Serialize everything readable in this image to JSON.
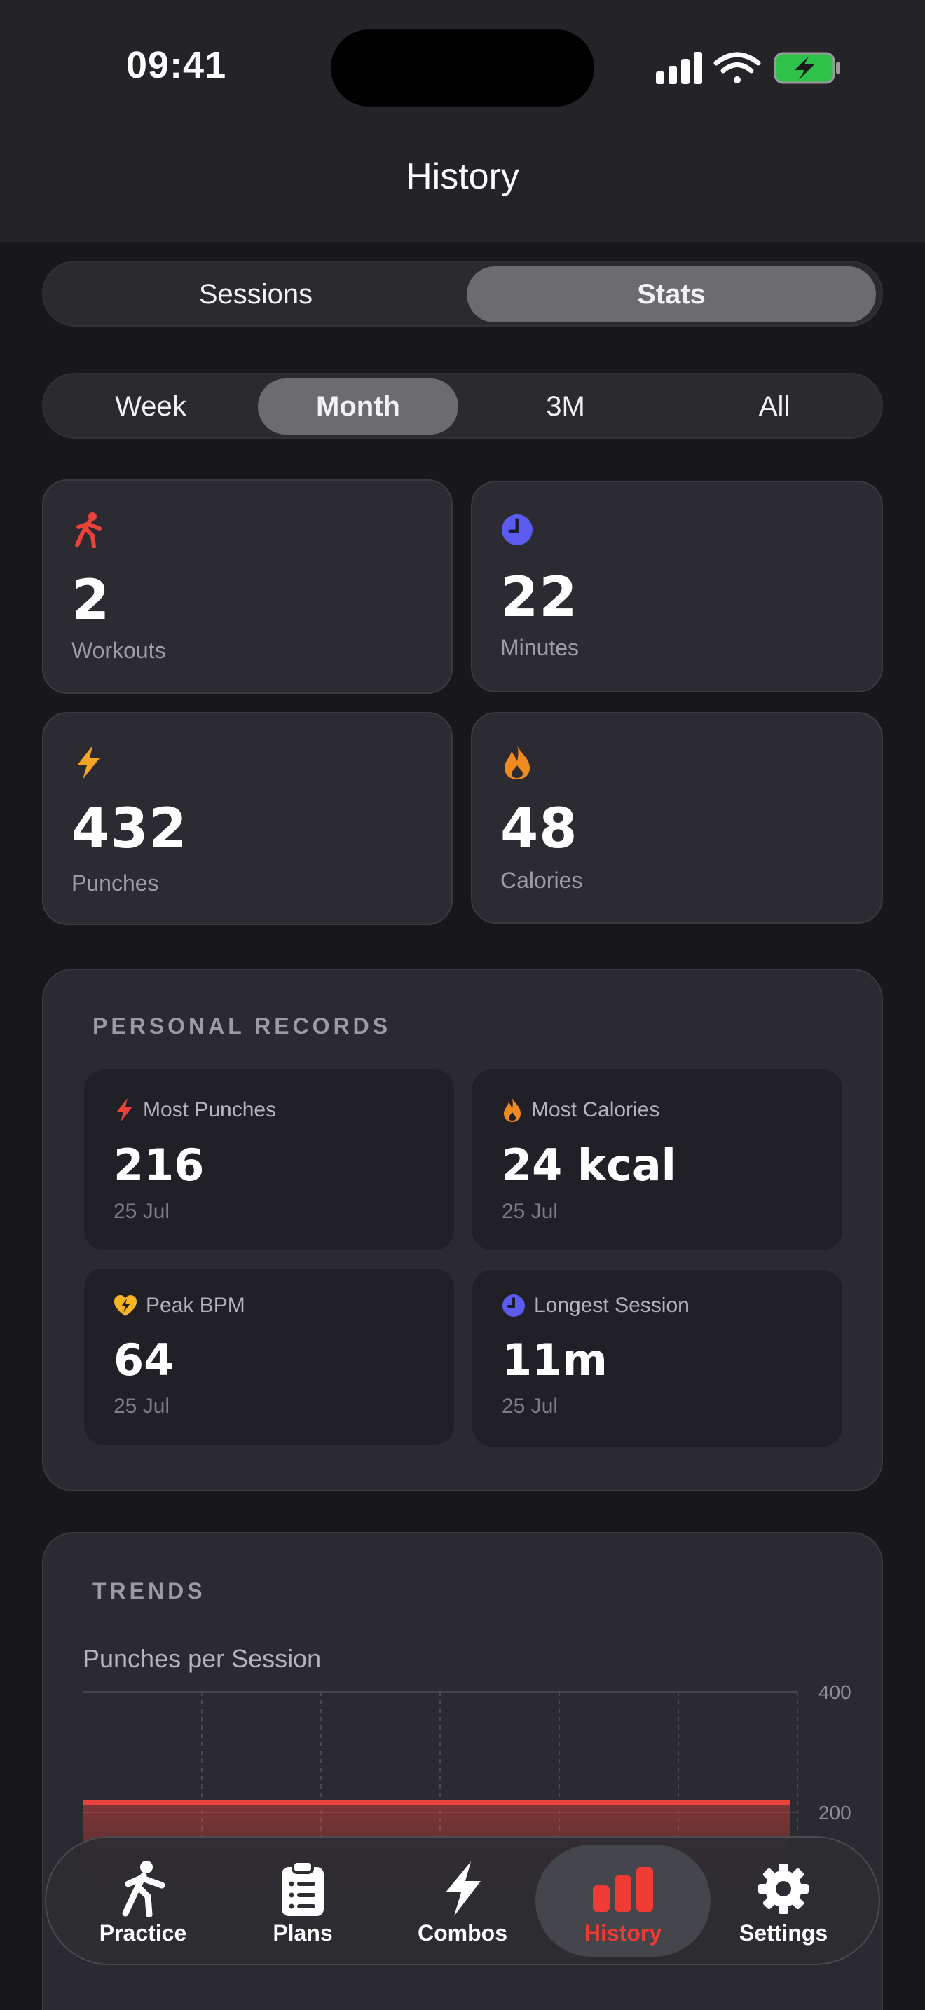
{
  "status_bar": {
    "time": "09:41"
  },
  "header": {
    "title": "History"
  },
  "view_toggle": {
    "options": [
      "Sessions",
      "Stats"
    ],
    "selected": "Stats"
  },
  "period_filter": {
    "options": [
      "Week",
      "Month",
      "3M",
      "All"
    ],
    "selected": "Month"
  },
  "stats": [
    {
      "icon": "running-figure-icon",
      "value": "2",
      "label": "Workouts",
      "color": "#e8423a"
    },
    {
      "icon": "clock-icon",
      "value": "22",
      "label": "Minutes",
      "color": "#5b5bf0"
    },
    {
      "icon": "bolt-icon",
      "value": "432",
      "label": "Punches",
      "color": "#f5a524"
    },
    {
      "icon": "flame-icon",
      "value": "48",
      "label": "Calories",
      "color": "#f08a1f"
    }
  ],
  "personal_records": {
    "title": "PERSONAL RECORDS",
    "items": [
      {
        "icon": "bolt-icon",
        "label": "Most Punches",
        "value": "216",
        "date": "25 Jul",
        "color": "#e8423a"
      },
      {
        "icon": "flame-icon",
        "label": "Most Calories",
        "value": "24 kcal",
        "date": "25 Jul",
        "color": "#f08a1f"
      },
      {
        "icon": "heart-bolt-icon",
        "label": "Peak BPM",
        "value": "64",
        "date": "25 Jul",
        "color": "#f5b524"
      },
      {
        "icon": "clock-icon",
        "label": "Longest Session",
        "value": "11m",
        "date": "25 Jul",
        "color": "#5b5bf0"
      }
    ]
  },
  "trends": {
    "title": "TRENDS",
    "chart_data": {
      "type": "area",
      "title": "Punches per Session",
      "y_ticks": [
        "400",
        "200"
      ],
      "ylim": [
        0,
        400
      ],
      "series": [
        {
          "values": [
            216,
            216
          ]
        }
      ],
      "color": "#e8423a",
      "grid": true
    }
  },
  "tab_bar": {
    "items": [
      {
        "label": "Practice",
        "icon": "running-figure-icon"
      },
      {
        "label": "Plans",
        "icon": "clipboard-icon"
      },
      {
        "label": "Combos",
        "icon": "bolt-icon"
      },
      {
        "label": "History",
        "icon": "bar-chart-icon"
      },
      {
        "label": "Settings",
        "icon": "gear-icon"
      }
    ],
    "selected": "History",
    "active_color": "#ef3b33"
  }
}
